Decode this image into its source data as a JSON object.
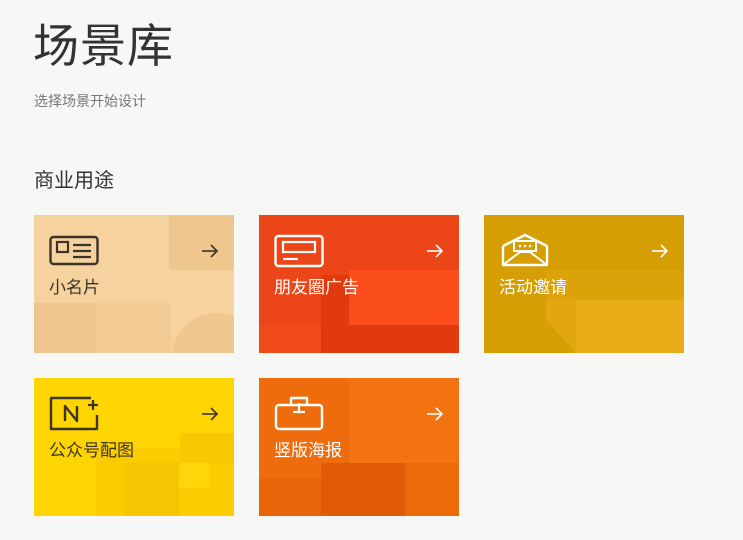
{
  "header": {
    "title": "场景库",
    "subtitle": "选择场景开始设计"
  },
  "section": {
    "title": "商业用途"
  },
  "cards": [
    {
      "label": "小名片",
      "icon": "business-card-icon",
      "arrow": "arrow-right-icon",
      "color": "#f6d29e"
    },
    {
      "label": "朋友圈广告",
      "icon": "moments-ad-icon",
      "arrow": "arrow-right-icon",
      "color": "#eb4518"
    },
    {
      "label": "活动邀请",
      "icon": "invitation-envelope-icon",
      "arrow": "arrow-right-icon",
      "color": "#d59e02"
    },
    {
      "label": "公众号配图",
      "icon": "official-account-image-icon",
      "arrow": "arrow-right-icon",
      "color": "#ffd500"
    },
    {
      "label": "竖版海报",
      "icon": "poster-bag-icon",
      "arrow": "arrow-right-icon",
      "color": "#ef6c0c"
    }
  ]
}
